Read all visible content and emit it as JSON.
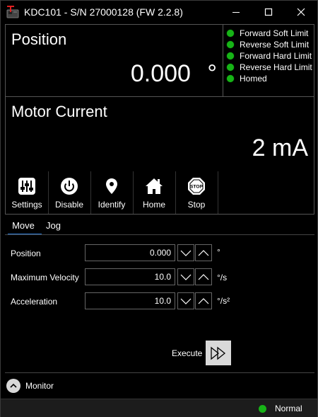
{
  "window": {
    "title": "KDC101 - S/N 27000128 (FW 2.2.8)",
    "controls": [
      "minimize-icon",
      "maximize-icon",
      "close-icon"
    ]
  },
  "position": {
    "title": "Position",
    "value": "0.000",
    "unit": "°"
  },
  "limits": [
    {
      "label": "Forward Soft Limit",
      "state": "ok"
    },
    {
      "label": "Reverse Soft Limit",
      "state": "ok"
    },
    {
      "label": "Forward Hard Limit",
      "state": "ok"
    },
    {
      "label": "Reverse Hard Limit",
      "state": "ok"
    },
    {
      "label": "Homed",
      "state": "ok"
    }
  ],
  "motor_current": {
    "title": "Motor Current",
    "value": "2 mA"
  },
  "toolbar": {
    "settings": "Settings",
    "disable": "Disable",
    "identify": "Identify",
    "home": "Home",
    "stop": "Stop"
  },
  "tabs": {
    "move": "Move",
    "jog": "Jog",
    "active": "Move"
  },
  "move_form": {
    "position": {
      "label": "Position",
      "value": "0.000",
      "unit": "°"
    },
    "max_velocity": {
      "label": "Maximum Velocity",
      "value": "10.0",
      "unit": "°/s"
    },
    "acceleration": {
      "label": "Acceleration",
      "value": "10.0",
      "unit": "°/s²"
    },
    "execute_label": "Execute"
  },
  "monitor": {
    "label": "Monitor"
  },
  "status": {
    "text": "Normal"
  },
  "colors": {
    "led_green": "#17b317",
    "accent": "#2e7bd6",
    "background": "#000000"
  }
}
